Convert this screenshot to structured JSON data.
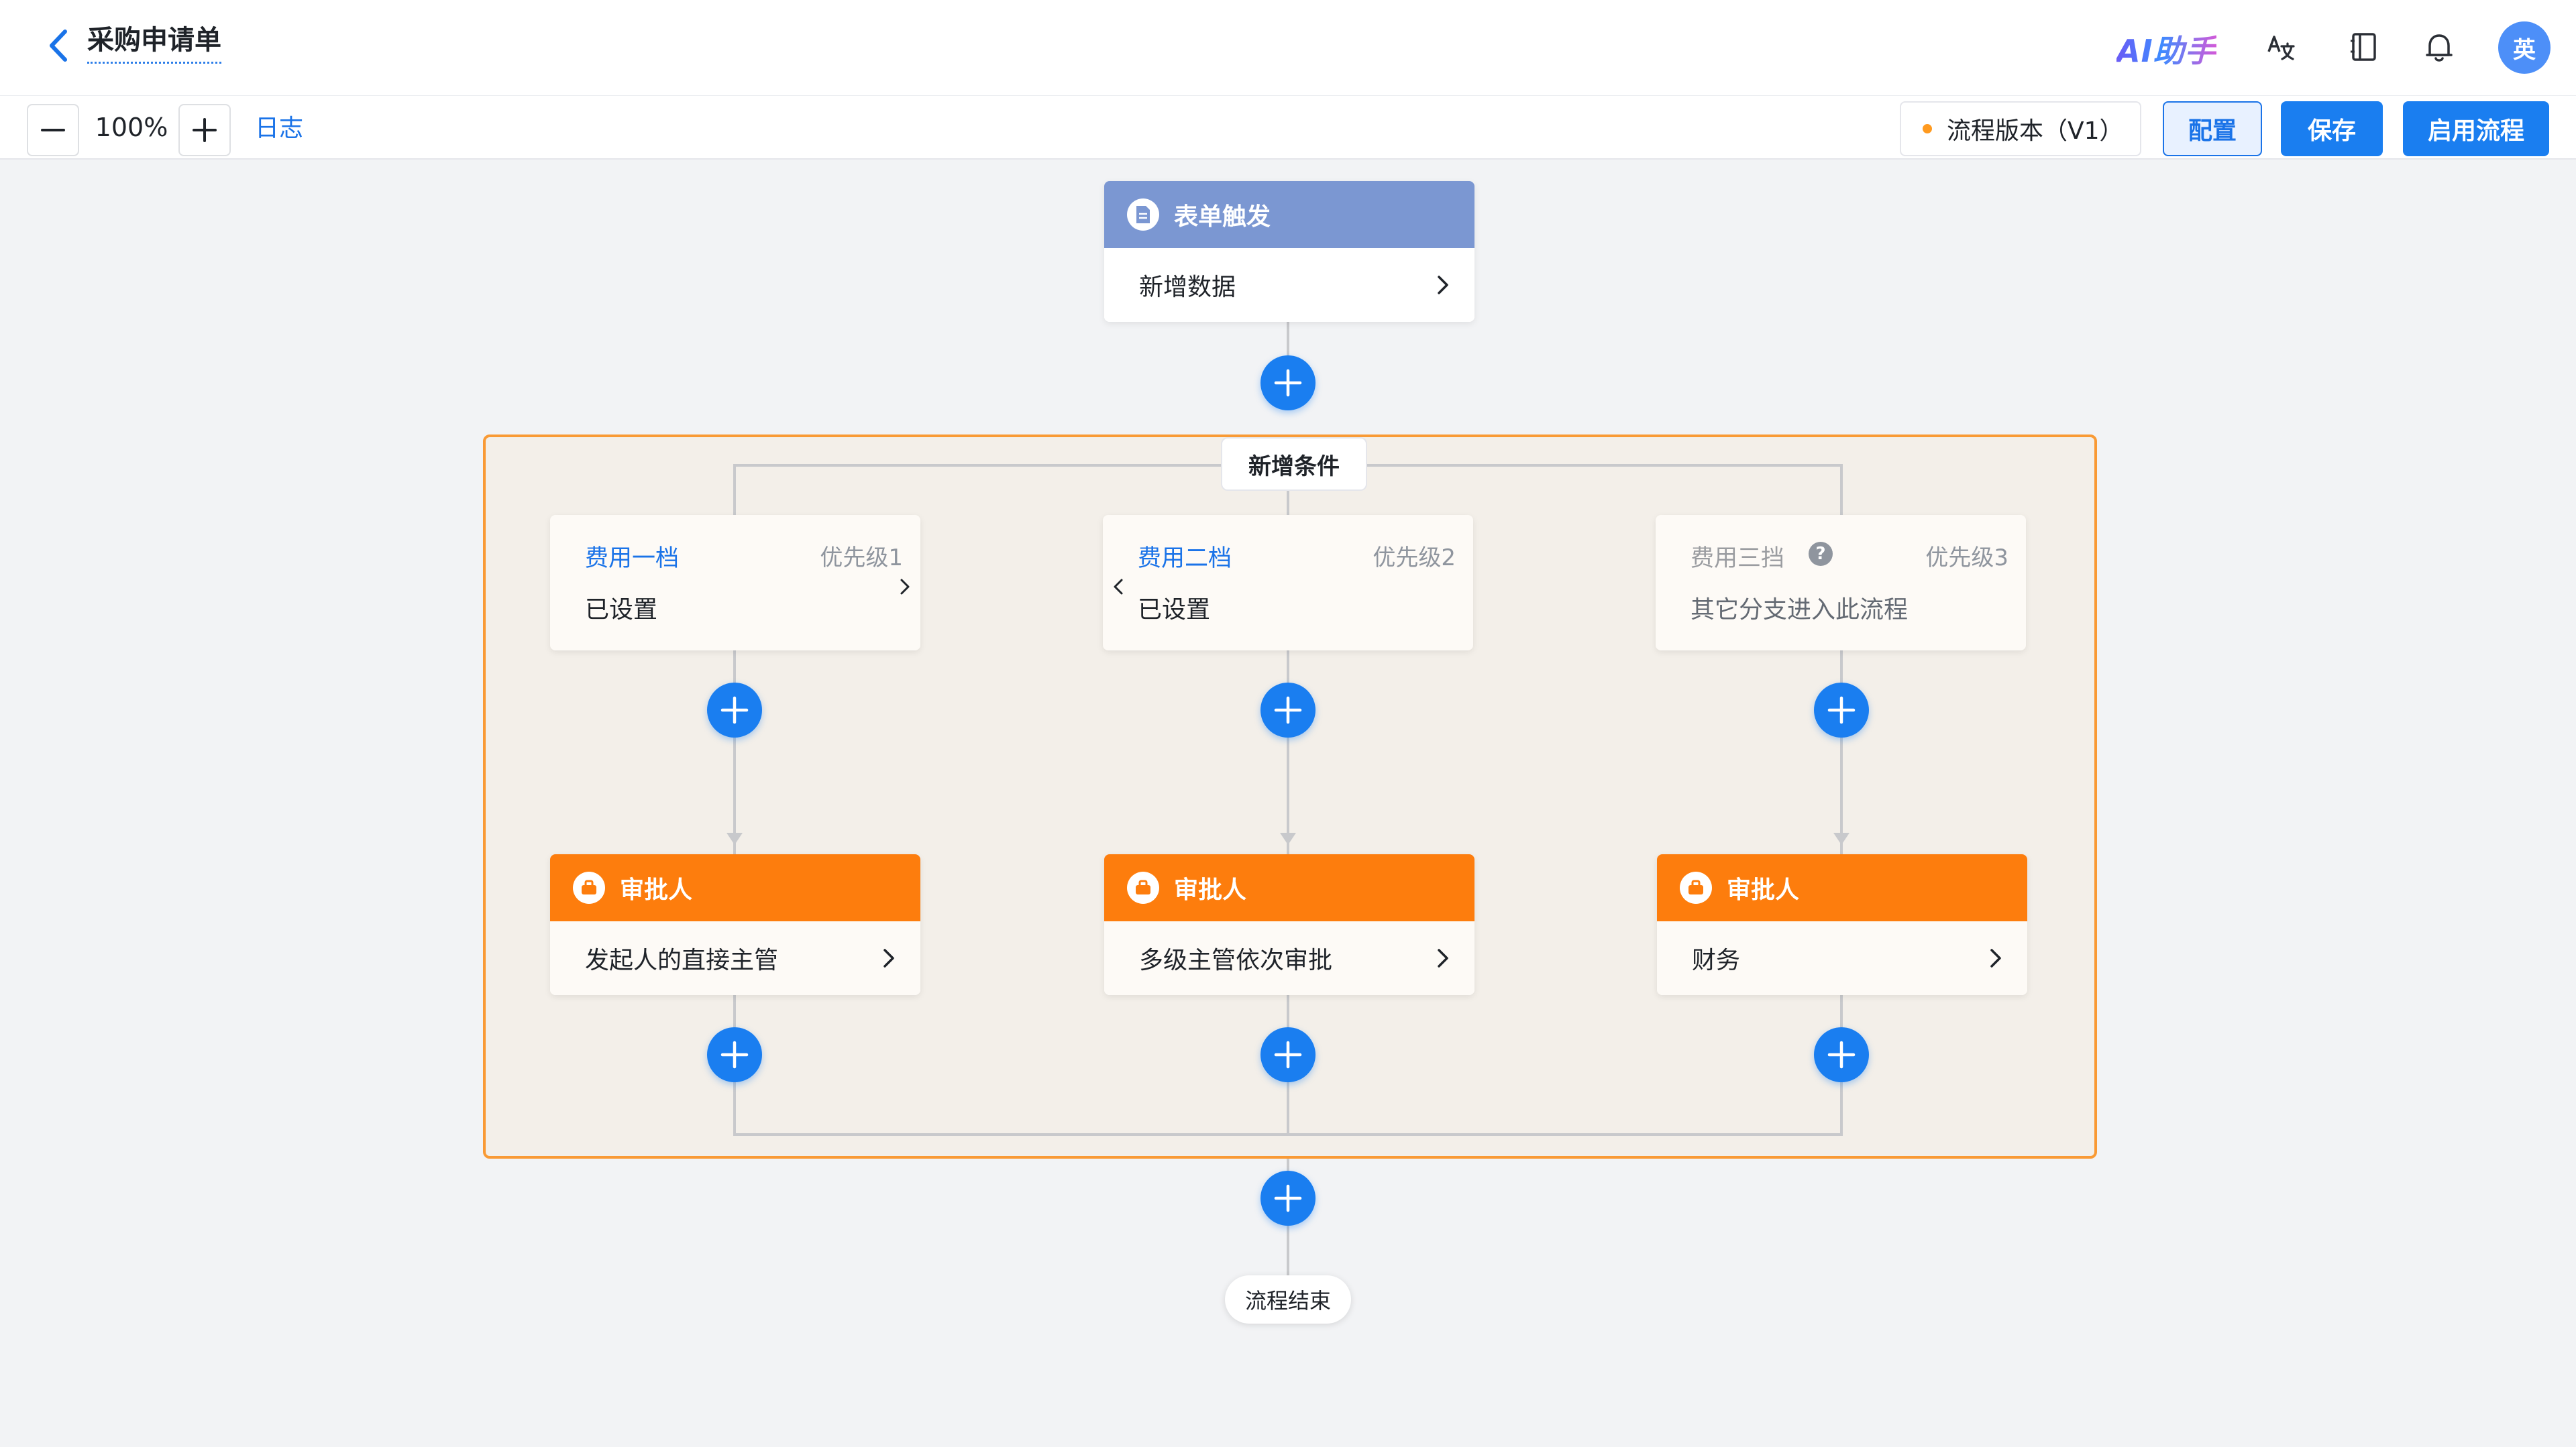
{
  "header": {
    "title": "采购申请单",
    "ai_label": "AI助手",
    "avatar_text": "英"
  },
  "toolbar": {
    "zoom": "100%",
    "log_label": "日志",
    "version_label": "流程版本（V1）",
    "config_label": "配置",
    "save_label": "保存",
    "enable_label": "启用流程"
  },
  "flow": {
    "trigger": {
      "title": "表单触发",
      "action": "新增数据"
    },
    "add_condition_label": "新增条件",
    "branches": [
      {
        "condition": {
          "name": "费用一档",
          "priority": "优先级1",
          "desc": "已设置"
        },
        "approver": {
          "title": "审批人",
          "desc": "发起人的直接主管"
        }
      },
      {
        "condition": {
          "name": "费用二档",
          "priority": "优先级2",
          "desc": "已设置"
        },
        "approver": {
          "title": "审批人",
          "desc": "多级主管依次审批"
        }
      },
      {
        "condition": {
          "name": "费用三挡",
          "priority": "优先级3",
          "desc": "其它分支进入此流程",
          "help": "?"
        },
        "approver": {
          "title": "审批人",
          "desc": "财务"
        }
      }
    ],
    "end_label": "流程结束"
  },
  "colors": {
    "primary": "#1a7ef0",
    "trigger_header": "#7b97d2",
    "approver_header": "#fd7d0d",
    "branch_border": "#f99a35",
    "branch_bg": "#f3efe9"
  },
  "icons": [
    "back-arrow-icon",
    "translate-icon",
    "notebook-icon",
    "bell-icon",
    "document-icon",
    "approver-icon",
    "plus-icon",
    "chevron-right-icon",
    "chevron-left-icon",
    "help-icon",
    "minus-icon"
  ]
}
